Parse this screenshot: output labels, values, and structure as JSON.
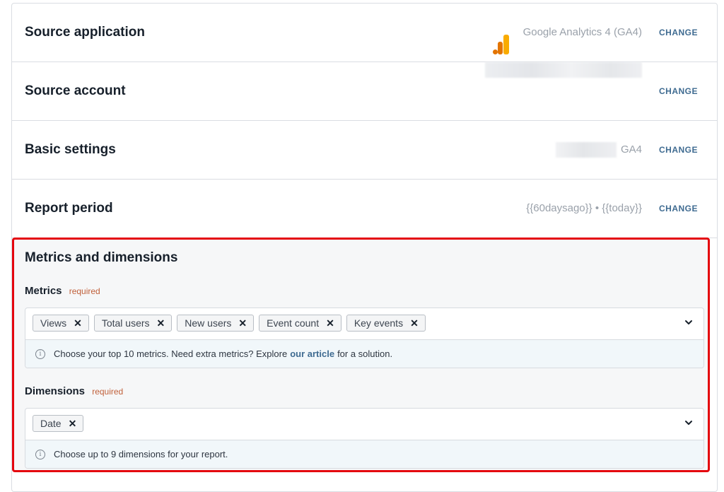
{
  "rows": [
    {
      "title": "Source application",
      "value": "Google Analytics 4 (GA4)",
      "change": "CHANGE",
      "icon": "google-analytics-icon"
    },
    {
      "title": "Source account",
      "value": "",
      "change": "CHANGE"
    },
    {
      "title": "Basic settings",
      "value": "GA4",
      "change": "CHANGE"
    },
    {
      "title": "Report period",
      "value": "{{60daysago}} • {{today}}",
      "change": "CHANGE"
    }
  ],
  "metrics_dimensions": {
    "title": "Metrics and dimensions",
    "metrics": {
      "label": "Metrics",
      "required": "required",
      "chips": [
        "Views",
        "Total users",
        "New users",
        "Event count",
        "Key events"
      ],
      "hint_before": "Choose your top 10 metrics. Need extra metrics? Explore",
      "hint_link": "our article",
      "hint_after": "for a solution."
    },
    "dimensions": {
      "label": "Dimensions",
      "required": "required",
      "chips": [
        "Date"
      ],
      "hint": "Choose up to 9 dimensions for your report."
    }
  },
  "colors": {
    "highlight_border": "#e4050e",
    "link": "#3f6b91",
    "required": "#c0603a",
    "ga_orange": "#f9ab00",
    "ga_dark_orange": "#e37400"
  }
}
